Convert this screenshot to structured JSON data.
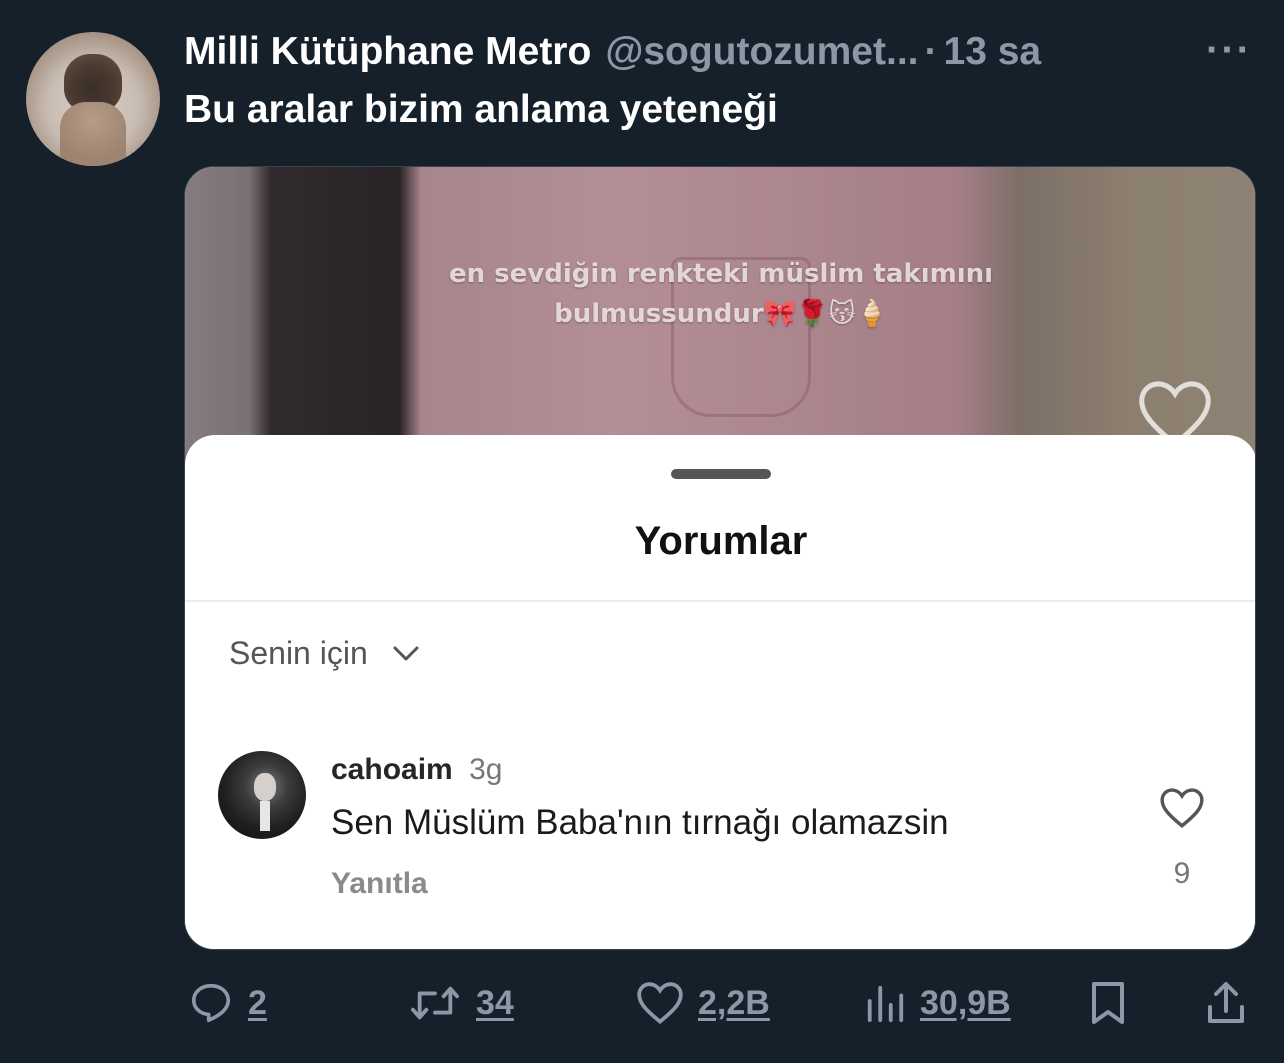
{
  "tweet": {
    "display_name": "Milli Kütüphane Metro",
    "handle": "@sogutozumet...",
    "separator": "·",
    "time": "13 sa",
    "more": "···",
    "text": "Bu aralar bizim anlama yeteneği"
  },
  "media": {
    "overlay_line1": "en sevdiğin renkteki müslim takımını",
    "overlay_line2": "bulmussundur🎀🌹😽🍦",
    "comments_sheet": {
      "title": "Yorumlar",
      "filter_label": "Senin için",
      "comment": {
        "username": "cahoaim",
        "age": "3g",
        "text": "Sen Müslüm Baba'nın tırnağı olamazsin",
        "reply_label": "Yanıtla",
        "like_count": "9"
      }
    }
  },
  "actions": {
    "replies": "2",
    "retweets": "34",
    "likes": "2,2B",
    "views": "30,9B"
  },
  "colors": {
    "background": "#15202b",
    "secondary_text": "#8b98a5",
    "primary_text": "#ffffff"
  },
  "icons": [
    "reply-icon",
    "retweet-icon",
    "like-icon",
    "views-icon",
    "bookmark-icon",
    "share-icon",
    "chevron-down-icon",
    "heart-outline-icon",
    "more-icon"
  ]
}
